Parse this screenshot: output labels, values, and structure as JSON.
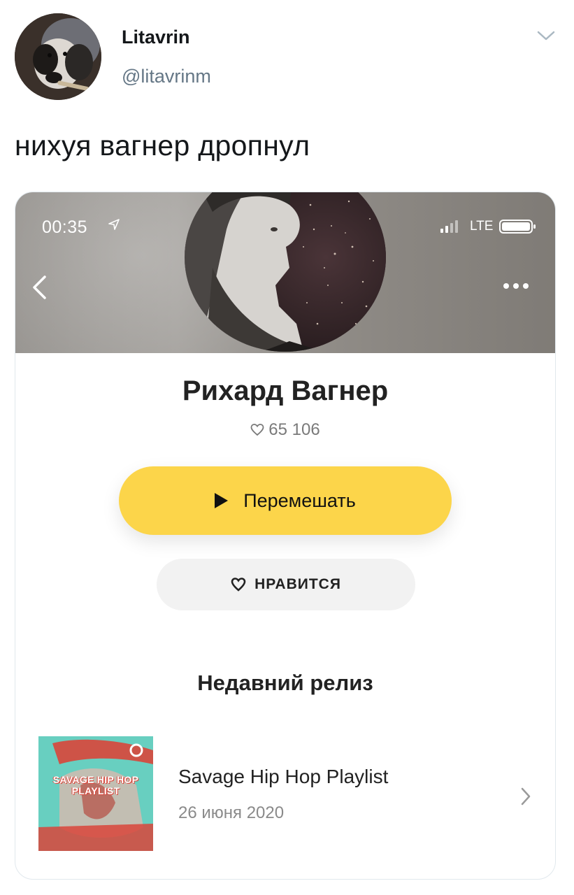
{
  "tweet": {
    "display_name": "Litavrin",
    "handle": "@litavrinm",
    "text": "нихуя вагнер дропнул"
  },
  "status_bar": {
    "time": "00:35",
    "network": "LTE"
  },
  "artist": {
    "name": "Рихард Вагнер",
    "likes": "65 106"
  },
  "buttons": {
    "shuffle_label": "Перемешать",
    "like_label": "НРАВИТСЯ"
  },
  "recent_release": {
    "section_title": "Недавний релиз",
    "title": "Savage Hip Hop Playlist",
    "date": "26 июня 2020",
    "cover_text": "SAVAGE HIP HOP PLAYLIST"
  },
  "colors": {
    "accent_yellow": "#fcd54a",
    "like_button_bg": "#f2f2f2",
    "handle_gray": "#657786",
    "cover_teal": "#68cfc0",
    "cover_red": "#d9453a"
  },
  "icons": [
    "user-avatar",
    "chevron-down-icon",
    "location-arrow-icon",
    "signal-icon",
    "battery-icon",
    "back-chevron-icon",
    "more-dots-icon",
    "heart-icon",
    "play-icon",
    "chevron-right-icon"
  ]
}
